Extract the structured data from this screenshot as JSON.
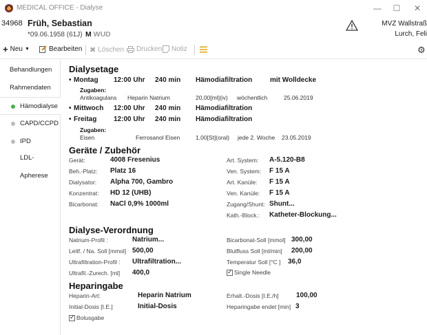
{
  "window": {
    "title": "MEDICAL OFFICE - Dialyse",
    "minimize": "—",
    "maximize": "☐",
    "close": "✕"
  },
  "patient": {
    "id": "34968",
    "name": "Früh, Sebastian",
    "dob": "*09.06.1958",
    "age": "(61J)",
    "sex_selected": "M",
    "sex_others": "WUD",
    "practice_line1": "MVZ Wallstraß",
    "practice_line2": "Lurch, Feli"
  },
  "toolbar": {
    "new": "Neu",
    "edit": "Bearbeiten",
    "delete": "Löschen",
    "print": "Drucken",
    "note": "Notiz"
  },
  "sidebar": {
    "items": [
      {
        "label": "Behandlungen"
      },
      {
        "label": "Rahmendaten"
      },
      {
        "label": "Hämodialyse"
      },
      {
        "label": "CAPD/CCPD"
      },
      {
        "label": "IPD"
      },
      {
        "label": "LDL-Apherese"
      }
    ]
  },
  "dialysetage": {
    "title": "Dialysetage",
    "days": [
      {
        "day": "Montag",
        "time": "12:00 Uhr",
        "duration": "240 min",
        "method": "Hämodiafiltration",
        "extra": "mit Wolldecke",
        "zugaben_label": "Zugaben:",
        "zugabe": {
          "type": "Antikoagulans",
          "drug": "Heparin Natrium",
          "dose": "20,00[ml](iv)",
          "freq": "wöchentlich",
          "date": "25.06.2019"
        }
      },
      {
        "day": "Mittwoch",
        "time": "12:00 Uhr",
        "duration": "240 min",
        "method": "Hämodiafiltration"
      },
      {
        "day": "Freitag",
        "time": "12:00 Uhr",
        "duration": "240 min",
        "method": "Hämodiafiltration",
        "zugaben_label": "Zugaben:",
        "zugabe": {
          "type": "Eisen",
          "drug": "Ferrosanol Eisen",
          "dose": "1,00[St](oral)",
          "freq": "jede 2. Woche",
          "date": "23.05.2019"
        }
      }
    ]
  },
  "geraete": {
    "title": "Geräte / Zubehör",
    "left": [
      {
        "label": "Gerät:",
        "value": "4008 Fresenius"
      },
      {
        "label": "Beh.-Platz:",
        "value": "Platz 16"
      },
      {
        "label": "Dialysator:",
        "value": "Alpha 700, Gambro"
      },
      {
        "label": "Konzentrat:",
        "value": "HD 12 (UHB)"
      },
      {
        "label": "Bicarbonat:",
        "value": "NaCl 0,9% 1000ml"
      }
    ],
    "right": [
      {
        "label": "Art. System:",
        "value": "A-5.120-B8"
      },
      {
        "label": "Ven. System:",
        "value": "F 15 A"
      },
      {
        "label": "Art. Kanüle:",
        "value": "F 15 A"
      },
      {
        "label": "Ven. Kanüle:",
        "value": "F 15 A"
      },
      {
        "label": "Zugang/Shunt:",
        "value": "Shunt..."
      },
      {
        "label": "Kath.-Block.:",
        "value": "Katheter-Blockung..."
      }
    ]
  },
  "verordnung": {
    "title": "Dialyse-Verordnung",
    "left": [
      {
        "label": "Natrium-Profil :",
        "value": "Natrium..."
      },
      {
        "label": "Leitf. / Na. Soll [mmol]",
        "value": "500,00"
      },
      {
        "label": "Ultrafiltration-Profil :",
        "value": "Ultrafiltration..."
      },
      {
        "label": "Ultrafil.-Zurech. [ml]",
        "value": "400,0"
      }
    ],
    "right": [
      {
        "label": "Bicarbonat-Soll [mmol]",
        "value": "300,00"
      },
      {
        "label": "Blutfluss Soll [ml/min]",
        "value": "200,00"
      },
      {
        "label": "Temperatur Soll [°C ]",
        "value": "36,0"
      }
    ],
    "single_needle": "Single Needle"
  },
  "heparin": {
    "title": "Heparingabe",
    "art_label": "Heparin-Art:",
    "art_value": "Heparin Natrium",
    "init_label": "Initial-Dosis [I.E.]",
    "init_value": "Initial-Dosis",
    "erh_label": "Erhalt.-Dosis [I.E./h]",
    "erh_value": "100,00",
    "end_label": "Heparingabe endet [min]",
    "end_value": "3",
    "bolus": "Bolusgabe"
  }
}
